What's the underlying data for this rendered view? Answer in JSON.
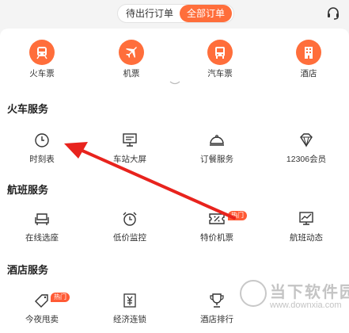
{
  "tabs": [
    "待出行订单",
    "全部订单"
  ],
  "categories": [
    {
      "label": "火车票",
      "icon": "train-icon"
    },
    {
      "label": "机票",
      "icon": "plane-icon"
    },
    {
      "label": "汽车票",
      "icon": "bus-icon"
    },
    {
      "label": "酒店",
      "icon": "hotel-icon"
    }
  ],
  "sections": [
    {
      "title": "火车服务",
      "items": [
        {
          "label": "时刻表",
          "icon": "clock-icon"
        },
        {
          "label": "车站大屏",
          "icon": "screen-icon"
        },
        {
          "label": "订餐服务",
          "icon": "dish-icon"
        },
        {
          "label": "12306会员",
          "icon": "diamond-icon"
        }
      ]
    },
    {
      "title": "航班服务",
      "items": [
        {
          "label": "在线选座",
          "icon": "seat-icon"
        },
        {
          "label": "低价监控",
          "icon": "alarm-clock-icon"
        },
        {
          "label": "特价机票",
          "icon": "discount-ticket-icon",
          "badge": "热门"
        },
        {
          "label": "航班动态",
          "icon": "chart-icon"
        }
      ]
    },
    {
      "title": "酒店服务",
      "items": [
        {
          "label": "今夜甩卖",
          "icon": "tag-icon",
          "badge": "热门"
        },
        {
          "label": "经济连锁",
          "icon": "yuan-icon"
        },
        {
          "label": "酒店排行",
          "icon": "trophy-icon"
        }
      ]
    }
  ],
  "watermark": {
    "title": "当下软件园",
    "url": "www.downxia.com"
  },
  "colors": {
    "accent": "#ff6e3b",
    "badge": "#ff5a35",
    "arrow": "#e8231d"
  }
}
